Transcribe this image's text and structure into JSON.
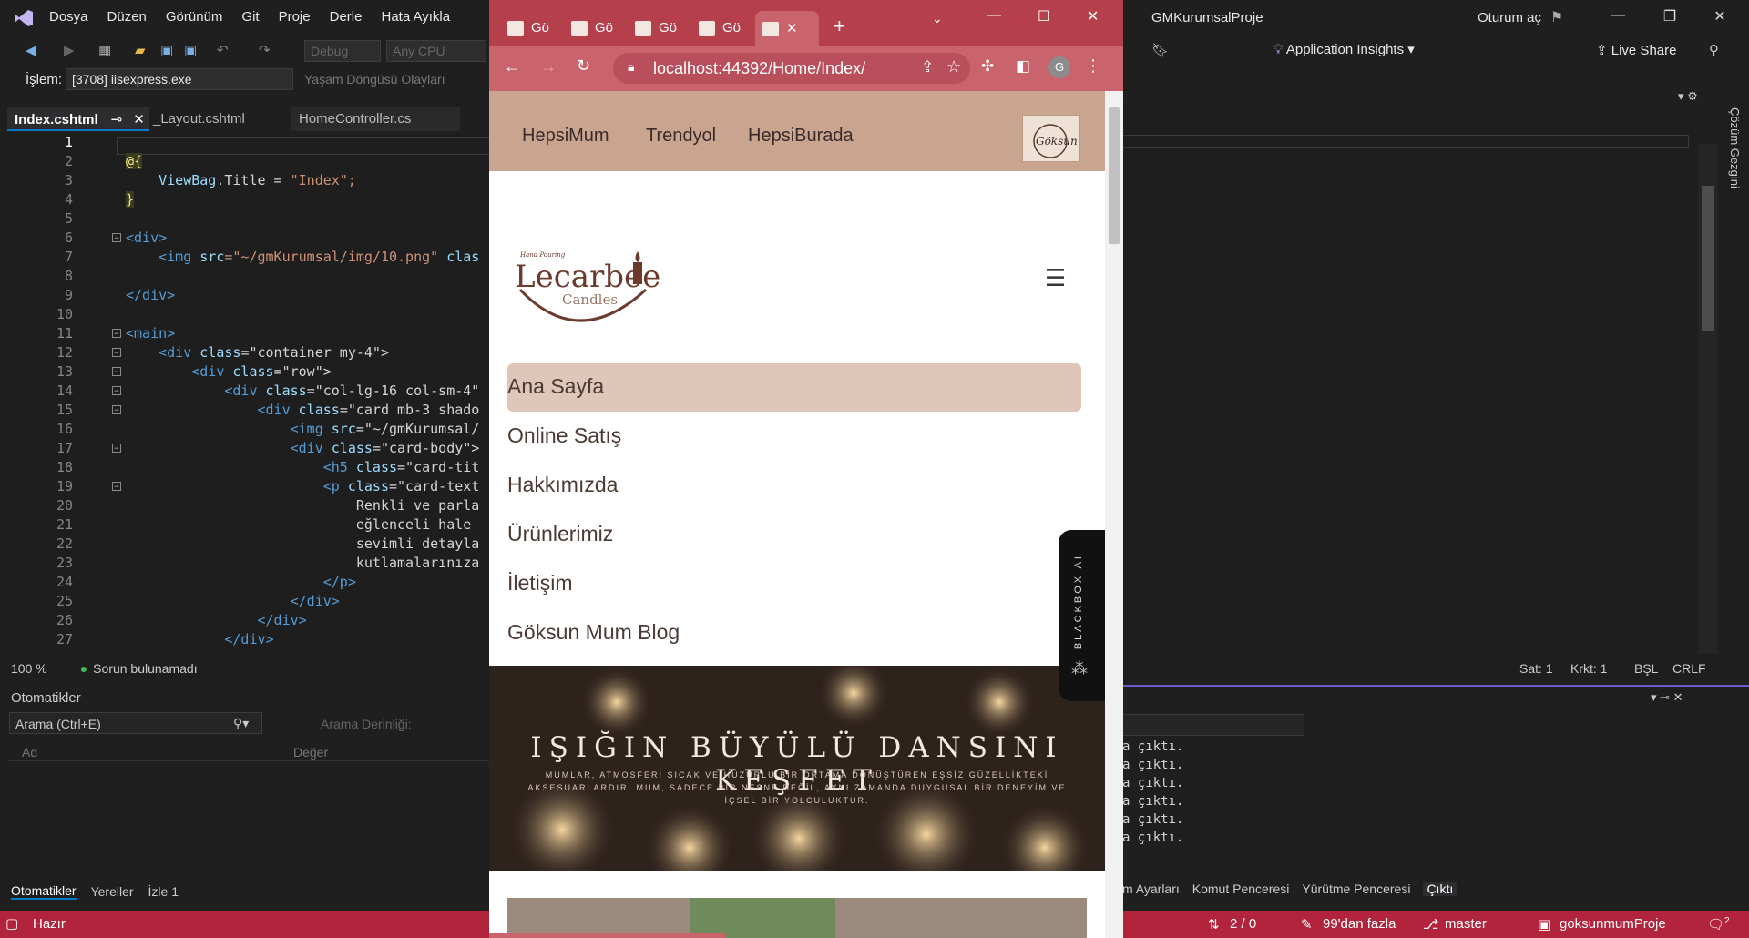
{
  "vs": {
    "menu": [
      "Dosya",
      "Düzen",
      "Görünüm",
      "Git",
      "Proje",
      "Derle",
      "Hata Ayıkla"
    ],
    "project_title": "GMKurumsalProje",
    "signin": "Oturum aç",
    "toolbar": {
      "config": "Debug",
      "platform": "Any CPU",
      "app_insights": "Application Insights",
      "live_share": "Live Share"
    },
    "process": {
      "label": "İşlem:",
      "value": "[3708] iisexpress.exe",
      "lifecycle": "Yaşam Döngüsü Olayları"
    },
    "doc_tabs": {
      "active": "Index.cshtml",
      "second": "_Layout.cshtml",
      "third": "HomeController.cs"
    },
    "code_lines": [
      "1",
      "2",
      "3",
      "4",
      "5",
      "6",
      "7",
      "8",
      "9",
      "10",
      "11",
      "12",
      "13",
      "14",
      "15",
      "16",
      "17",
      "18",
      "19",
      "20",
      "21",
      "22",
      "23",
      "24",
      "25",
      "26",
      "27"
    ],
    "code": {
      "l2": "@{",
      "l3_a": "ViewBag",
      "l3_b": ".Title = ",
      "l3_c": "\"Index\";",
      "l4": "}",
      "l6": "<div>",
      "l7_a": "<img ",
      "l7_b": "src",
      "l7_c": "=\"~/gmKurumsal/img/10.png\" ",
      "l7_d": "clas",
      "l9": "</div>",
      "l11": "<main>",
      "l12_a": "<div ",
      "l12_b": "class",
      "l12_c": "=\"container my-4\">",
      "l13_c": "=\"row\">",
      "l14_c": "=\"col-lg-16 col-sm-4\"",
      "l15_c": "=\"card mb-3 shado",
      "l16_a": "<img ",
      "l16_b": "src",
      "l16_c": "=\"~/gmKurumsal/",
      "l17_c": "=\"card-body\">",
      "l18_a": "<h5 ",
      "l18_c": "=\"card-tit",
      "l19_a": "<p ",
      "l19_c": "=\"card-text",
      "l20": "Renkli ve parla",
      "l21": "eğlenceli hale ",
      "l22": "sevimli detayla",
      "l23": "kutlamalarınıza",
      "l24": "</p>",
      "l25": "</div>",
      "l26": "</div>",
      "l27": "</div>"
    },
    "editor_status": {
      "zoom": "100 %",
      "issues": "Sorun bulunamadı"
    },
    "right_status": {
      "line": "Sat: 1",
      "col": "Krkt: 1",
      "mode": "BŞL",
      "eol": "CRLF"
    },
    "autos": {
      "title": "Otomatikler",
      "search": "Arama (Ctrl+E)",
      "depth": "Arama Derinliği:",
      "col_name": "Ad",
      "col_value": "Değer",
      "tabs": [
        "Otomatikler",
        "Yereller",
        "İzle 1"
      ]
    },
    "output_lines": [
      "a çıktı.",
      "a çıktı.",
      "a çıktı.",
      "a çıktı.",
      "a çıktı.",
      "a çıktı."
    ],
    "bottom_tabs": [
      "m Ayarları",
      "Komut Penceresi",
      "Yürütme Penceresi",
      "Çıktı"
    ],
    "solution_explorer": "Çözüm Gezgini",
    "statusbar": {
      "ready": "Hazır",
      "sync": "2 / 0",
      "changes": "99'dan fazla",
      "branch": "master",
      "repo": "goksunmumProje",
      "notif": "2"
    }
  },
  "browser": {
    "tab_label": "Gö",
    "url": "localhost:44392/Home/Index/",
    "profile": "G",
    "topnav": [
      "HepsiMum",
      "Trendyol",
      "HepsiBurada"
    ],
    "logo": {
      "brand": "Lecarbee",
      "sub": "Candles",
      "tag": "Hand Pouring"
    },
    "nav": [
      "Ana Sayfa",
      "Online Satış",
      "Hakkımızda",
      "Ürünlerimiz",
      "İletişim",
      "Göksun Mum Blog"
    ],
    "hero_title": "IŞIĞIN BÜYÜLÜ DANSINI KEŞFET",
    "hero_sub": "MUMLAR, ATMOSFERİ SICAK VE HUZURLU BİR ORTAMA DÖNÜŞTÜREN EŞSİZ GÜZELLİKTEKİ AKSESUARLARDIR. MUM, SADECE BİR NESNE DEĞİL, AYNI ZAMANDA DUYGUSAL BİR DENEYİM VE İÇSEL BİR YOLCULUKTUR.",
    "blackbox": "BLACKBOX AI"
  },
  "colors": {
    "accent": "#b1243b",
    "browser_frame": "#c9636c",
    "nav_bg": "#c9a48f",
    "active_nav": "#dfc6b9"
  }
}
